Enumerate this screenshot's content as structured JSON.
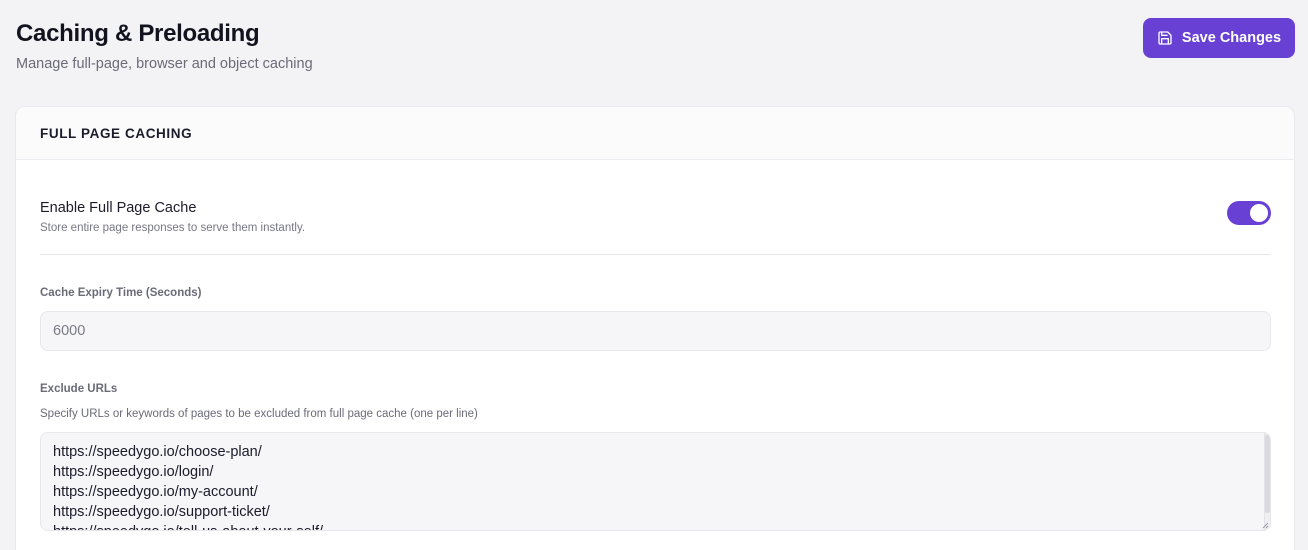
{
  "header": {
    "title": "Caching & Preloading",
    "subtitle": "Manage full-page, browser and object caching",
    "save_label": "Save Changes",
    "save_icon": "floppy-disk-icon"
  },
  "colors": {
    "accent": "#6841d4",
    "background": "#f3f3f5",
    "card": "#ffffff",
    "input_bg": "#f6f6f8"
  },
  "section": {
    "title": "FULL PAGE CACHING",
    "enable": {
      "label": "Enable Full Page Cache",
      "description": "Store entire page responses to serve them instantly.",
      "enabled": true
    },
    "expiry": {
      "label": "Cache Expiry Time (Seconds)",
      "value": "6000"
    },
    "exclude": {
      "label": "Exclude URLs",
      "hint": "Specify URLs or keywords of pages to be excluded from full page cache (one per line)",
      "lines": [
        "https://speedygo.io/choose-plan/",
        "https://speedygo.io/login/",
        "https://speedygo.io/my-account/",
        "https://speedygo.io/support-ticket/",
        "https://speedygo.io/tell-us-about-your-self/"
      ]
    }
  }
}
